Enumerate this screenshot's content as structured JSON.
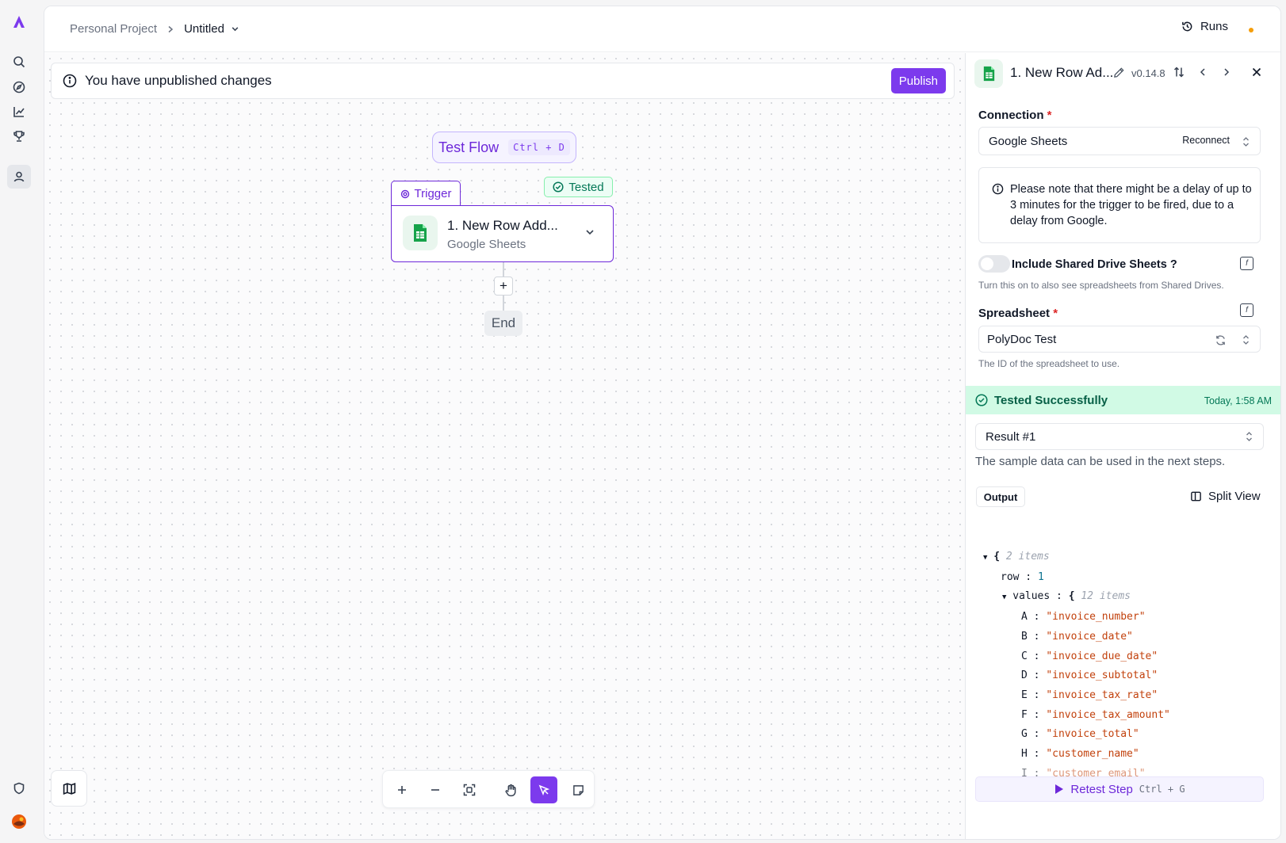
{
  "breadcrumb": {
    "project": "Personal Project",
    "flow": "Untitled"
  },
  "header": {
    "runs_label": "Runs",
    "status_dot_color": "#f59e0b"
  },
  "banner": {
    "message": "You have unpublished changes",
    "publish_label": "Publish"
  },
  "canvas": {
    "test_flow_label": "Test Flow",
    "test_flow_shortcut": "Ctrl + D",
    "trigger_tab": "Trigger",
    "tested_tab": "Tested",
    "step_title": "1. New Row Add...",
    "step_subtitle": "Google Sheets",
    "plus_label": "+",
    "end_label": "End"
  },
  "toolbar": {
    "items": [
      "zoom-in",
      "zoom-out",
      "fit-view",
      "hand-tool",
      "select-tool",
      "note-tool"
    ],
    "selected": "select-tool"
  },
  "panel": {
    "title": "1. New Row Ad...",
    "version": "v0.14.8",
    "connection_label": "Connection",
    "required_mark": "*",
    "connection_value": "Google Sheets",
    "reconnect_label": "Reconnect",
    "note": "Please note that there might be a delay of up to 3 minutes for the trigger to be fired, due to a delay from Google.",
    "shared_label": "Include Shared Drive Sheets ?",
    "shared_help": "Turn this on to also see spreadsheets from Shared Drives.",
    "shared_on": false,
    "spreadsheet_label": "Spreadsheet",
    "spreadsheet_value": "PolyDoc Test",
    "spreadsheet_help": "The ID of the spreadsheet to use.",
    "success_label": "Tested Successfully",
    "success_time": "Today, 1:58 AM",
    "result_value": "Result #1",
    "sample_text": "The sample data can be used in the next steps.",
    "output_label": "Output",
    "split_label": "Split View",
    "retest_label": "Retest Step",
    "retest_shortcut": "Ctrl + G"
  },
  "json_view": {
    "root_meta": "2 items",
    "row_key": "row",
    "row_value": "1",
    "values_key": "values",
    "values_meta": "12 items",
    "values": [
      {
        "k": "A",
        "v": "\"invoice_number\""
      },
      {
        "k": "B",
        "v": "\"invoice_date\""
      },
      {
        "k": "C",
        "v": "\"invoice_due_date\""
      },
      {
        "k": "D",
        "v": "\"invoice_subtotal\""
      },
      {
        "k": "E",
        "v": "\"invoice_tax_rate\""
      },
      {
        "k": "F",
        "v": "\"invoice_tax_amount\""
      },
      {
        "k": "G",
        "v": "\"invoice_total\""
      },
      {
        "k": "H",
        "v": "\"customer_name\""
      },
      {
        "k": "I",
        "v": "\"customer_email\""
      }
    ]
  },
  "colors": {
    "accent": "#7c3aed",
    "success": "#047857",
    "sheets_green": "#16a34a"
  }
}
